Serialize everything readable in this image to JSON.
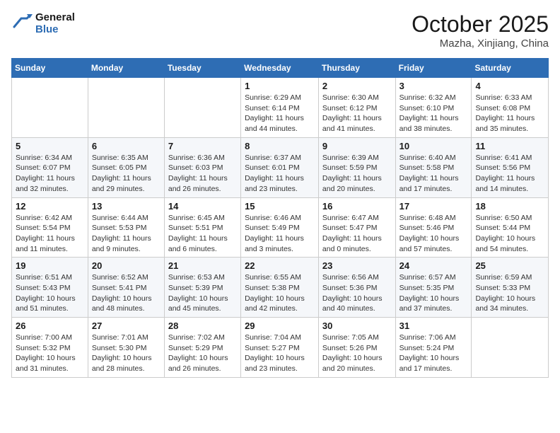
{
  "header": {
    "logo_line1": "General",
    "logo_line2": "Blue",
    "month_title": "October 2025",
    "location": "Mazha, Xinjiang, China"
  },
  "days_of_week": [
    "Sunday",
    "Monday",
    "Tuesday",
    "Wednesday",
    "Thursday",
    "Friday",
    "Saturday"
  ],
  "weeks": [
    [
      {
        "day": "",
        "info": ""
      },
      {
        "day": "",
        "info": ""
      },
      {
        "day": "",
        "info": ""
      },
      {
        "day": "1",
        "info": "Sunrise: 6:29 AM\nSunset: 6:14 PM\nDaylight: 11 hours\nand 44 minutes."
      },
      {
        "day": "2",
        "info": "Sunrise: 6:30 AM\nSunset: 6:12 PM\nDaylight: 11 hours\nand 41 minutes."
      },
      {
        "day": "3",
        "info": "Sunrise: 6:32 AM\nSunset: 6:10 PM\nDaylight: 11 hours\nand 38 minutes."
      },
      {
        "day": "4",
        "info": "Sunrise: 6:33 AM\nSunset: 6:08 PM\nDaylight: 11 hours\nand 35 minutes."
      }
    ],
    [
      {
        "day": "5",
        "info": "Sunrise: 6:34 AM\nSunset: 6:07 PM\nDaylight: 11 hours\nand 32 minutes."
      },
      {
        "day": "6",
        "info": "Sunrise: 6:35 AM\nSunset: 6:05 PM\nDaylight: 11 hours\nand 29 minutes."
      },
      {
        "day": "7",
        "info": "Sunrise: 6:36 AM\nSunset: 6:03 PM\nDaylight: 11 hours\nand 26 minutes."
      },
      {
        "day": "8",
        "info": "Sunrise: 6:37 AM\nSunset: 6:01 PM\nDaylight: 11 hours\nand 23 minutes."
      },
      {
        "day": "9",
        "info": "Sunrise: 6:39 AM\nSunset: 5:59 PM\nDaylight: 11 hours\nand 20 minutes."
      },
      {
        "day": "10",
        "info": "Sunrise: 6:40 AM\nSunset: 5:58 PM\nDaylight: 11 hours\nand 17 minutes."
      },
      {
        "day": "11",
        "info": "Sunrise: 6:41 AM\nSunset: 5:56 PM\nDaylight: 11 hours\nand 14 minutes."
      }
    ],
    [
      {
        "day": "12",
        "info": "Sunrise: 6:42 AM\nSunset: 5:54 PM\nDaylight: 11 hours\nand 11 minutes."
      },
      {
        "day": "13",
        "info": "Sunrise: 6:44 AM\nSunset: 5:53 PM\nDaylight: 11 hours\nand 9 minutes."
      },
      {
        "day": "14",
        "info": "Sunrise: 6:45 AM\nSunset: 5:51 PM\nDaylight: 11 hours\nand 6 minutes."
      },
      {
        "day": "15",
        "info": "Sunrise: 6:46 AM\nSunset: 5:49 PM\nDaylight: 11 hours\nand 3 minutes."
      },
      {
        "day": "16",
        "info": "Sunrise: 6:47 AM\nSunset: 5:47 PM\nDaylight: 11 hours\nand 0 minutes."
      },
      {
        "day": "17",
        "info": "Sunrise: 6:48 AM\nSunset: 5:46 PM\nDaylight: 10 hours\nand 57 minutes."
      },
      {
        "day": "18",
        "info": "Sunrise: 6:50 AM\nSunset: 5:44 PM\nDaylight: 10 hours\nand 54 minutes."
      }
    ],
    [
      {
        "day": "19",
        "info": "Sunrise: 6:51 AM\nSunset: 5:43 PM\nDaylight: 10 hours\nand 51 minutes."
      },
      {
        "day": "20",
        "info": "Sunrise: 6:52 AM\nSunset: 5:41 PM\nDaylight: 10 hours\nand 48 minutes."
      },
      {
        "day": "21",
        "info": "Sunrise: 6:53 AM\nSunset: 5:39 PM\nDaylight: 10 hours\nand 45 minutes."
      },
      {
        "day": "22",
        "info": "Sunrise: 6:55 AM\nSunset: 5:38 PM\nDaylight: 10 hours\nand 42 minutes."
      },
      {
        "day": "23",
        "info": "Sunrise: 6:56 AM\nSunset: 5:36 PM\nDaylight: 10 hours\nand 40 minutes."
      },
      {
        "day": "24",
        "info": "Sunrise: 6:57 AM\nSunset: 5:35 PM\nDaylight: 10 hours\nand 37 minutes."
      },
      {
        "day": "25",
        "info": "Sunrise: 6:59 AM\nSunset: 5:33 PM\nDaylight: 10 hours\nand 34 minutes."
      }
    ],
    [
      {
        "day": "26",
        "info": "Sunrise: 7:00 AM\nSunset: 5:32 PM\nDaylight: 10 hours\nand 31 minutes."
      },
      {
        "day": "27",
        "info": "Sunrise: 7:01 AM\nSunset: 5:30 PM\nDaylight: 10 hours\nand 28 minutes."
      },
      {
        "day": "28",
        "info": "Sunrise: 7:02 AM\nSunset: 5:29 PM\nDaylight: 10 hours\nand 26 minutes."
      },
      {
        "day": "29",
        "info": "Sunrise: 7:04 AM\nSunset: 5:27 PM\nDaylight: 10 hours\nand 23 minutes."
      },
      {
        "day": "30",
        "info": "Sunrise: 7:05 AM\nSunset: 5:26 PM\nDaylight: 10 hours\nand 20 minutes."
      },
      {
        "day": "31",
        "info": "Sunrise: 7:06 AM\nSunset: 5:24 PM\nDaylight: 10 hours\nand 17 minutes."
      },
      {
        "day": "",
        "info": ""
      }
    ]
  ]
}
